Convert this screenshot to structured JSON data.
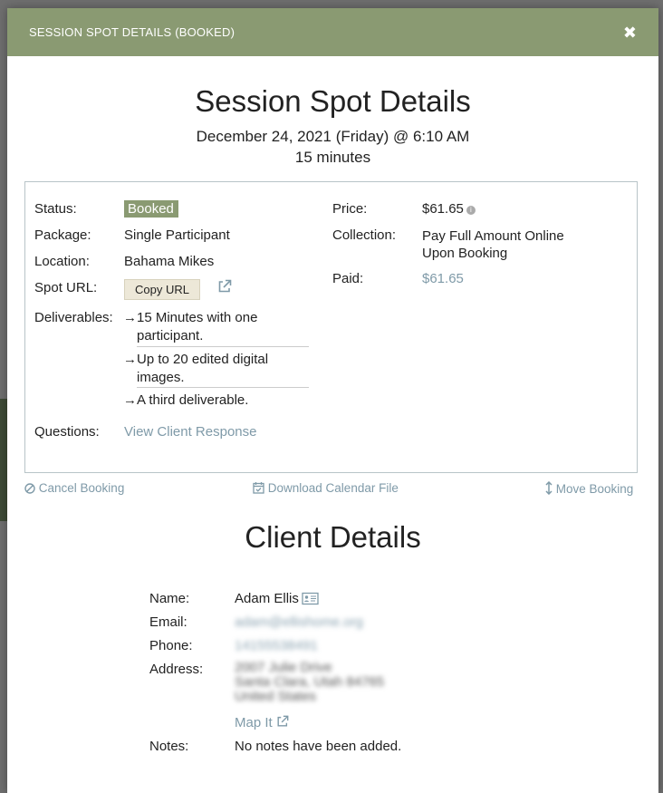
{
  "modal": {
    "title": "SESSION SPOT DETAILS (BOOKED)",
    "close_symbol": "✖"
  },
  "heading": {
    "title": "Session Spot Details",
    "date": "December 24, 2021 (Friday) @ 6:10 AM",
    "duration": "15 minutes"
  },
  "details": {
    "status_label": "Status:",
    "status_value": "Booked",
    "package_label": "Package:",
    "package_value": "Single Participant",
    "location_label": "Location:",
    "location_value": "Bahama Mikes",
    "spot_url_label": "Spot URL:",
    "copy_url_button": "Copy URL",
    "deliverables_label": "Deliverables:",
    "deliverables": [
      {
        "line1": "→15 Minutes with one",
        "line2": "participant."
      },
      {
        "line1": "→Up to 20 edited digital",
        "line2": "images."
      },
      {
        "line1": "→A third deliverable.",
        "line2": ""
      }
    ],
    "questions_label": "Questions:",
    "questions_link": "View Client Response",
    "price_label": "Price:",
    "price_value": "$61.65",
    "collection_label": "Collection:",
    "collection_line1": "Pay Full Amount Online",
    "collection_line2": "Upon Booking",
    "paid_label": "Paid:",
    "paid_value": "$61.65"
  },
  "actions": {
    "cancel": "Cancel Booking",
    "download": "Download Calendar File",
    "move": "Move Booking"
  },
  "client": {
    "heading": "Client Details",
    "name_label": "Name:",
    "name_value": "Adam Ellis",
    "email_label": "Email:",
    "email_value": "adam@ellishome.org",
    "phone_label": "Phone:",
    "phone_value": "14155538491",
    "address_label": "Address:",
    "address_line1": "2007 Julie Drive",
    "address_line2": "Santa Clara, Utah 84765",
    "address_line3": "United States",
    "map_link": "Map It",
    "notes_label": "Notes:",
    "notes_value": "No notes have been added."
  },
  "colors": {
    "header_bg": "#8a9a72",
    "link": "#7f9aa8",
    "badge_bg": "#8a9a72",
    "copy_btn_bg": "#ede8d8"
  },
  "icons": {
    "close": "close-icon",
    "info": "info-icon",
    "external_link": "external-link-icon",
    "cancel": "ban-icon",
    "calendar": "calendar-check-icon",
    "move": "vertical-arrows-icon",
    "contact_card": "contact-card-icon"
  }
}
